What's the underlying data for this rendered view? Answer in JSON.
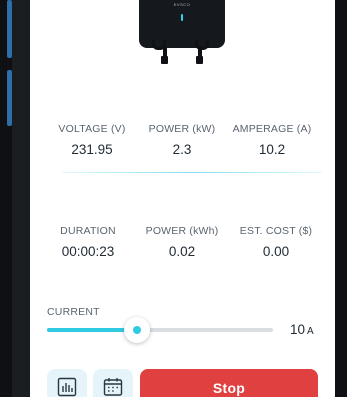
{
  "device": {
    "brand": "EVSCO"
  },
  "live_metrics": [
    {
      "label": "VOLTAGE (V)",
      "value": "231.95"
    },
    {
      "label": "POWER (kW)",
      "value": "2.3"
    },
    {
      "label": "AMPERAGE (A)",
      "value": "10.2"
    }
  ],
  "session_metrics": [
    {
      "label": "DURATION",
      "value": "00:00:23"
    },
    {
      "label": "POWER (kWh)",
      "value": "0.02"
    },
    {
      "label": "EST. COST ($)",
      "value": "0.00"
    }
  ],
  "current": {
    "label": "CURRENT",
    "value": "10",
    "unit": "A",
    "slider_fraction": 0.4,
    "accent_color": "#2fcbe3"
  },
  "actions": {
    "stats_icon": "bar-chart-icon",
    "schedule_icon": "calendar-icon",
    "stop_label": "Stop",
    "stop_color": "#e04040"
  }
}
